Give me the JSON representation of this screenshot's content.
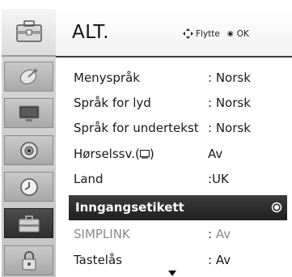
{
  "header": {
    "title": "ALT.",
    "hint_move": "Flytte",
    "hint_ok": "OK"
  },
  "sidebar": {
    "items": [
      {
        "name": "satellite-dish",
        "active": false
      },
      {
        "name": "monitor",
        "active": false
      },
      {
        "name": "speaker",
        "active": false
      },
      {
        "name": "clock",
        "active": false
      },
      {
        "name": "toolbox",
        "active": true
      },
      {
        "name": "padlock",
        "active": false
      }
    ]
  },
  "menu": {
    "rows": [
      {
        "label": "Menyspråk",
        "value": ": Norsk"
      },
      {
        "label": "Språk for lyd",
        "value": ": Norsk"
      },
      {
        "label": "Språk for undertekst",
        "value": ": Norsk"
      },
      {
        "label": "Hørselssv.",
        "value": "Av"
      },
      {
        "label": "Land",
        "value": ":UK"
      },
      {
        "label": "Inngangsetikett",
        "value": ""
      },
      {
        "label": "SIMPLINK",
        "value": "Av",
        "sep": ":"
      },
      {
        "label": "Tastelås",
        "value": ": Av"
      }
    ],
    "selected_index": 5,
    "disabled_index": 6
  },
  "colors": {
    "highlight": "#2a2a2a",
    "sidebar": "#c8c8c8",
    "disabled_text": "#8a8a8a"
  }
}
